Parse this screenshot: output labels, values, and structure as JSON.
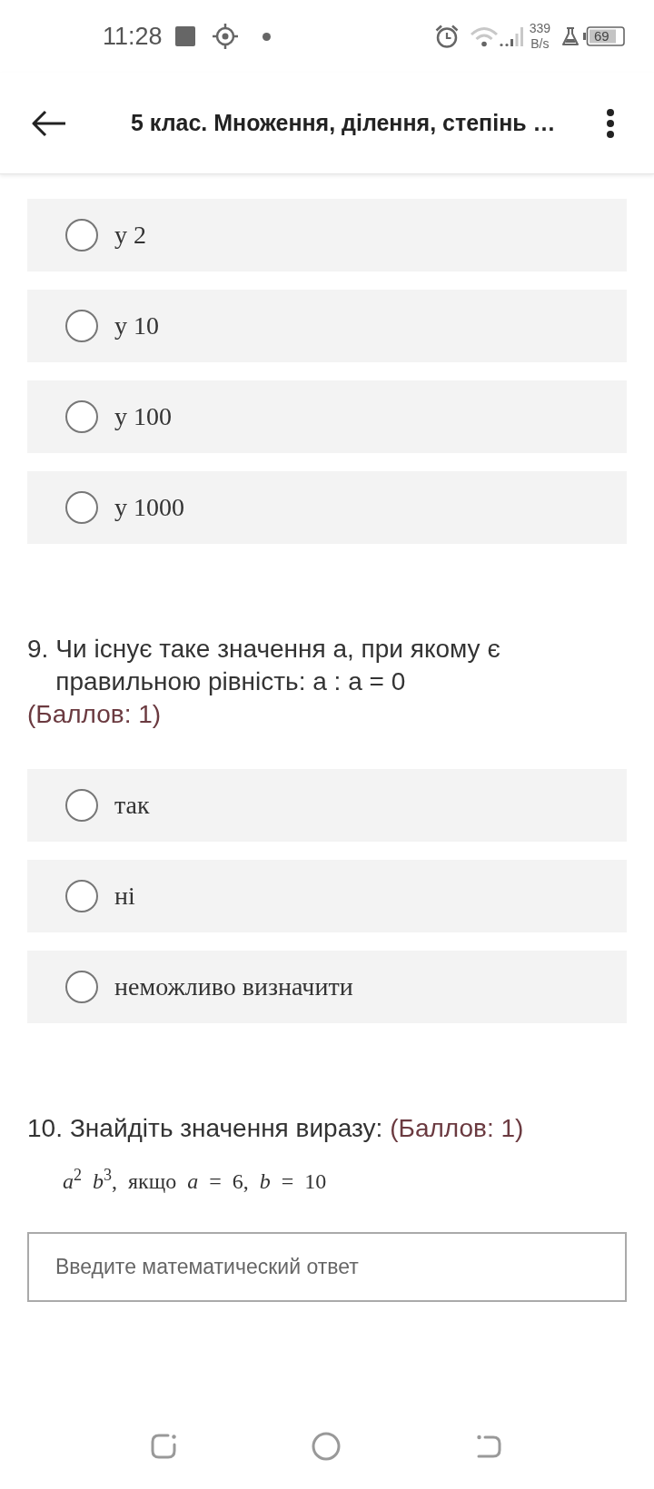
{
  "status_bar": {
    "time": "11:28",
    "network_speed": {
      "value": "339",
      "unit": "B/s"
    },
    "battery": "69"
  },
  "header": {
    "title": "5 клас. Множення, ділення, степінь …"
  },
  "questions": [
    {
      "kind": "choice",
      "options": [
        {
          "label": "у 2",
          "selected": false
        },
        {
          "label": "у 10",
          "selected": false
        },
        {
          "label": "у 100",
          "selected": false
        },
        {
          "label": "у 1000",
          "selected": false
        }
      ]
    },
    {
      "kind": "choice",
      "number": "9.",
      "text": "Чи існує таке значення а, при якому є правильною рівність: а : а = 0",
      "points": "(Баллов: 1)",
      "options": [
        {
          "label": "так",
          "selected": false
        },
        {
          "label": "ні",
          "selected": false
        },
        {
          "label": "неможливо визначити",
          "selected": false
        }
      ]
    },
    {
      "kind": "math",
      "number": "10.",
      "text": "Знайдіть значення виразу:",
      "points": "(Баллов: 1)",
      "formula": "*a*$^{2}$ *b*$^{3}$, якщо *a* = 6, *b* = 10",
      "answer": {
        "placeholder": "Введите математический ответ"
      }
    }
  ]
}
